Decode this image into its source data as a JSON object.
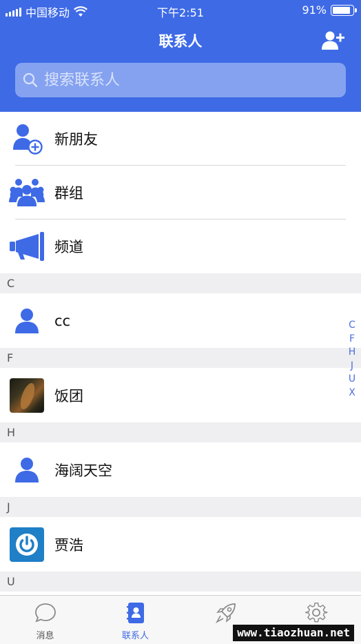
{
  "status_bar": {
    "carrier": "中国移动",
    "time": "下午2:51",
    "battery": "91%",
    "battery_level": 0.91
  },
  "nav": {
    "title": "联系人"
  },
  "search": {
    "placeholder": "搜索联系人"
  },
  "fixed_items": [
    {
      "label": "新朋友",
      "icon": "add-user-icon"
    },
    {
      "label": "群组",
      "icon": "group-icon"
    },
    {
      "label": "频道",
      "icon": "megaphone-icon"
    }
  ],
  "sections": [
    {
      "letter": "C",
      "contacts": [
        {
          "name": "cc",
          "avatar": "person-icon"
        }
      ]
    },
    {
      "letter": "F",
      "contacts": [
        {
          "name": "饭团",
          "avatar": "photo"
        }
      ]
    },
    {
      "letter": "H",
      "contacts": [
        {
          "name": "海阔天空",
          "avatar": "person-icon"
        }
      ]
    },
    {
      "letter": "J",
      "contacts": [
        {
          "name": "贾浩",
          "avatar": "power-icon"
        }
      ]
    },
    {
      "letter": "U",
      "contacts": []
    }
  ],
  "index_letters": [
    "C",
    "F",
    "H",
    "J",
    "U",
    "X"
  ],
  "tabs": [
    {
      "label": "消息",
      "icon": "chat-bubble-icon",
      "active": false
    },
    {
      "label": "联系人",
      "icon": "contacts-book-icon",
      "active": true
    },
    {
      "label": "",
      "icon": "rocket-icon",
      "active": false
    },
    {
      "label": "",
      "icon": "gear-icon",
      "active": false
    }
  ],
  "watermark": "www.tiaozhuan.net",
  "colors": {
    "brand": "#3e6ae6",
    "section_bg": "#efeff1",
    "index": "#4b6fde"
  }
}
